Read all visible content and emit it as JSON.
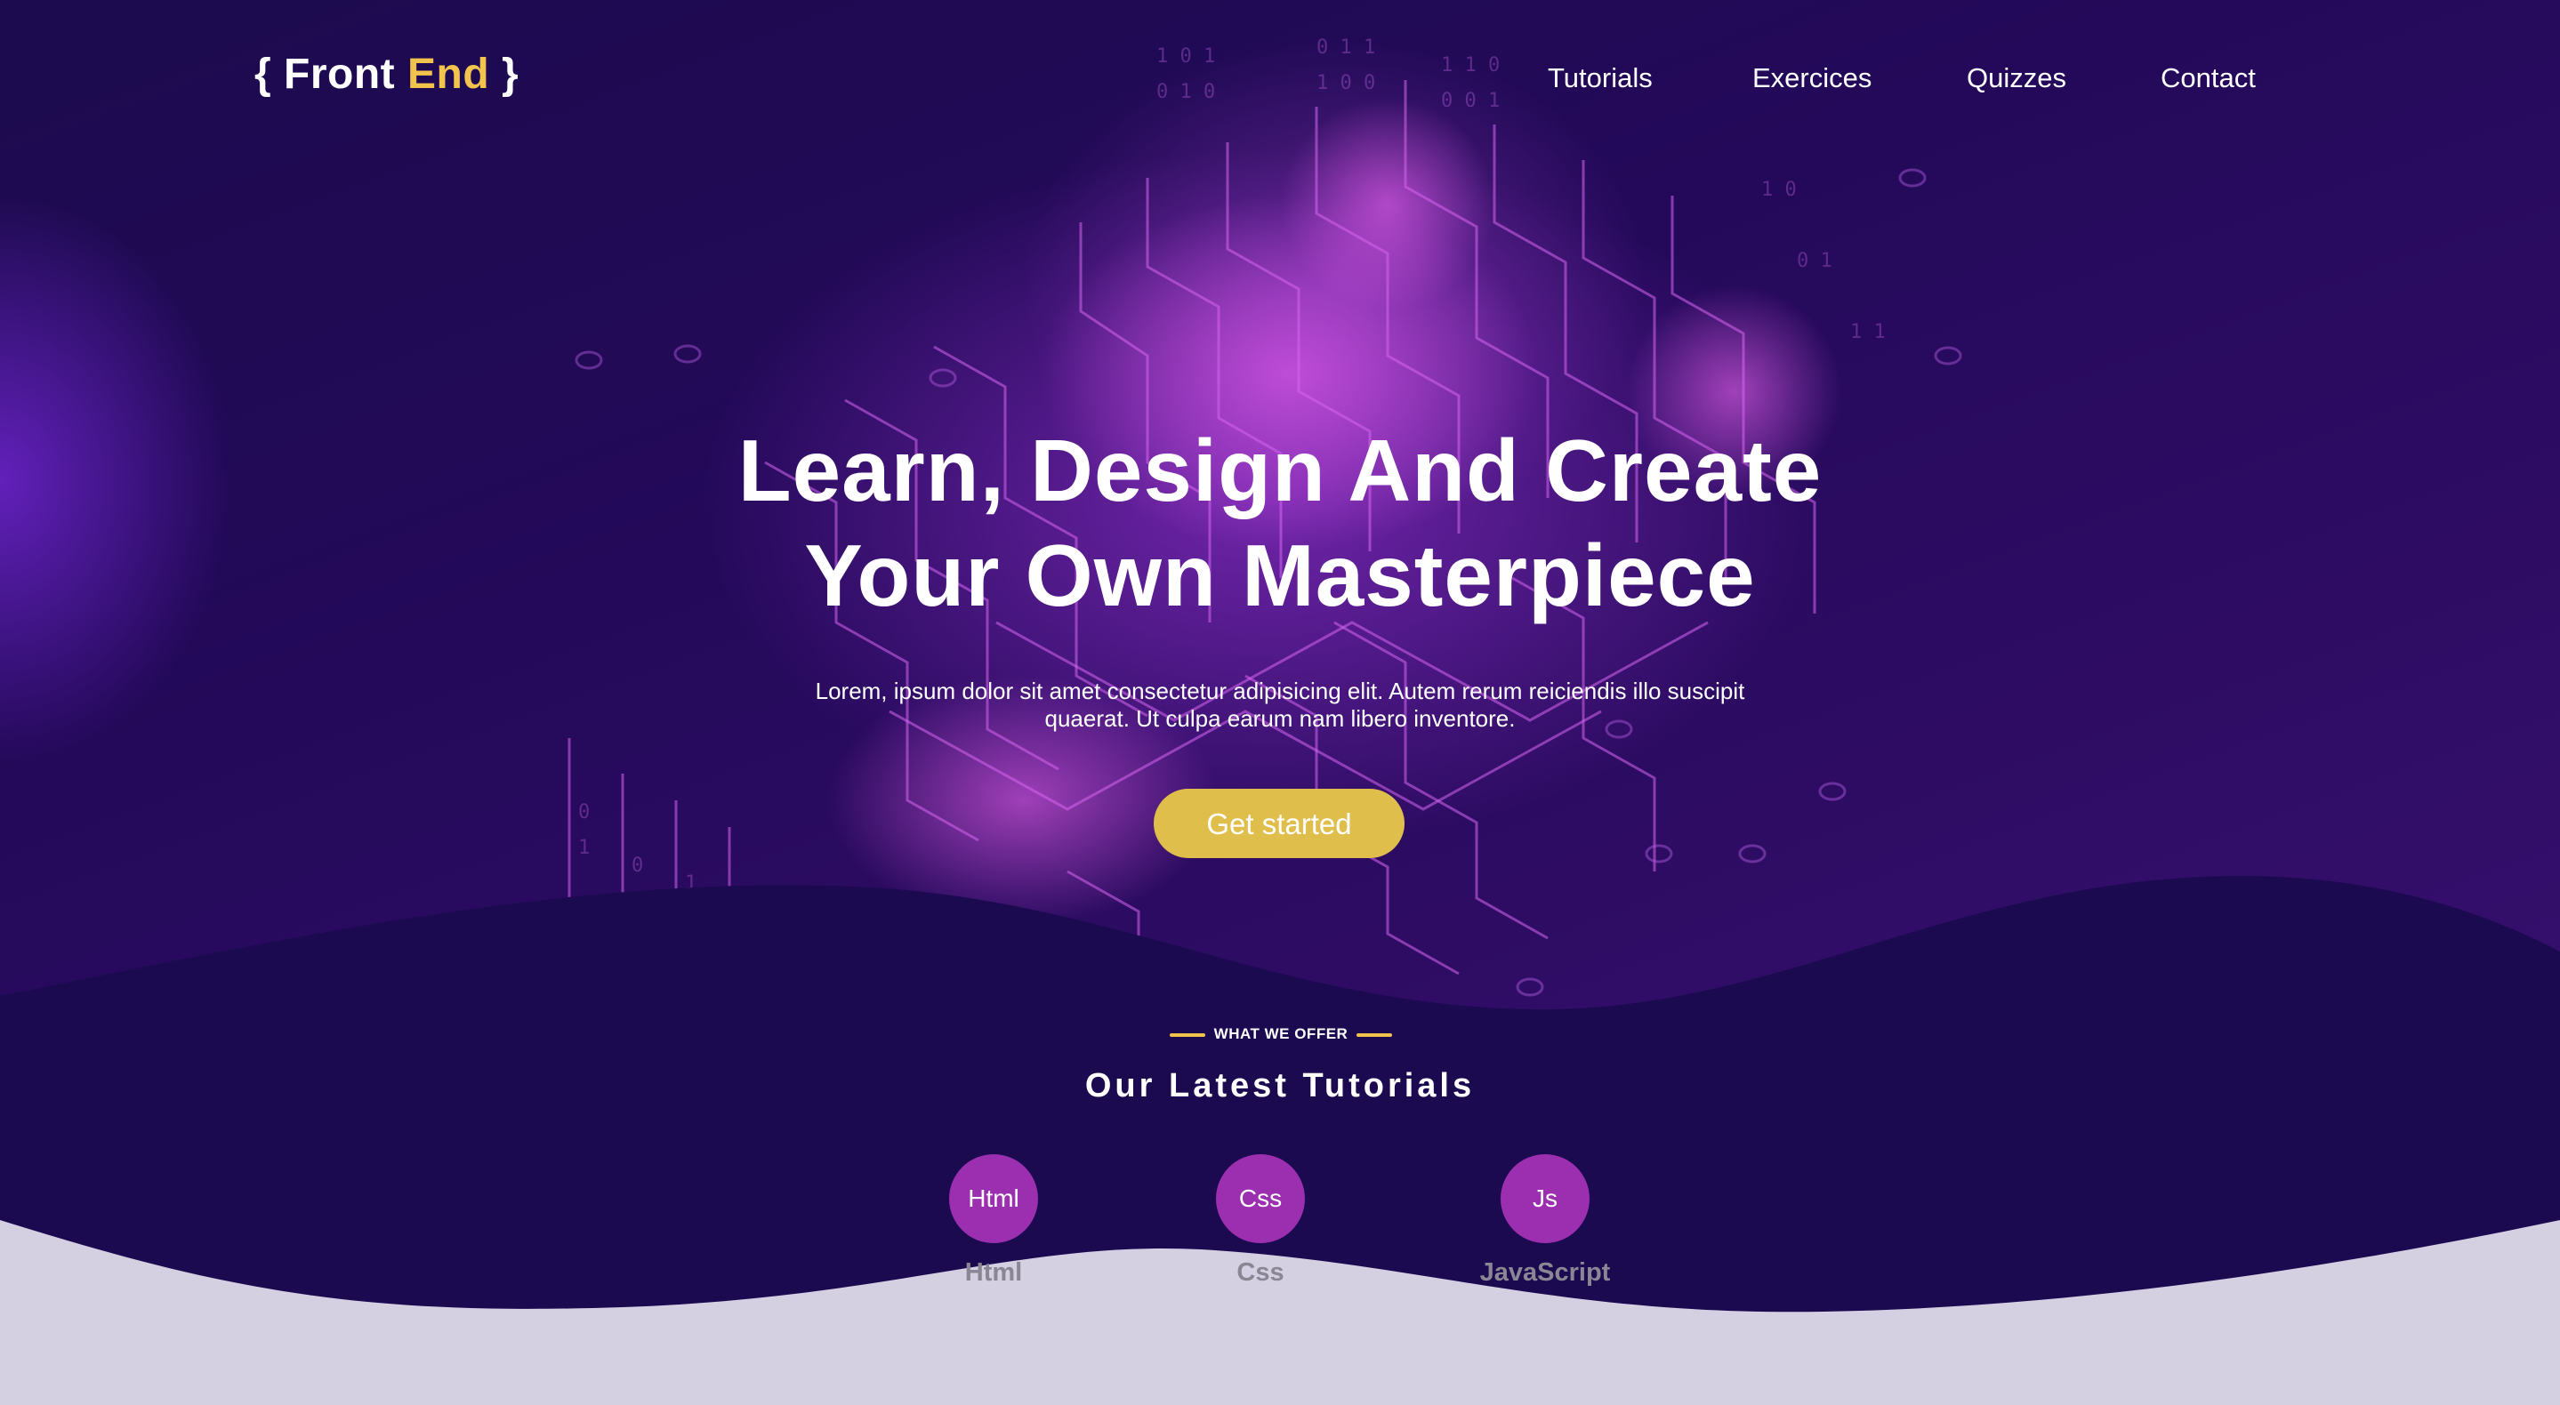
{
  "brand": {
    "open_brace": "{",
    "word1": "Front",
    "word2": "End",
    "close_brace": "}",
    "accent_color": "#f2c44d"
  },
  "nav": {
    "items": [
      {
        "label": "Tutorials"
      },
      {
        "label": "Exercices"
      },
      {
        "label": "Quizzes"
      },
      {
        "label": "Contact"
      }
    ]
  },
  "hero": {
    "title_line1": "Learn, Design And Create",
    "title_line2": "Your Own Masterpiece",
    "description_line1": "Lorem, ipsum dolor sit amet consectetur adipisicing elit. Autem rerum reiciendis illo suscipit",
    "description_line2": "quaerat. Ut culpa earum nam libero inventore.",
    "cta_label": "Get started",
    "cta_color": "#e0be4b"
  },
  "tutorials_section": {
    "eyebrow": "WHAT WE OFFER",
    "title": "Our Latest Tutorials",
    "items": [
      {
        "badge": "Html",
        "label": "Html"
      },
      {
        "badge": "Css",
        "label": "Css"
      },
      {
        "badge": "Js",
        "label": "JavaScript"
      }
    ],
    "badge_color": "#9b2fb0"
  }
}
